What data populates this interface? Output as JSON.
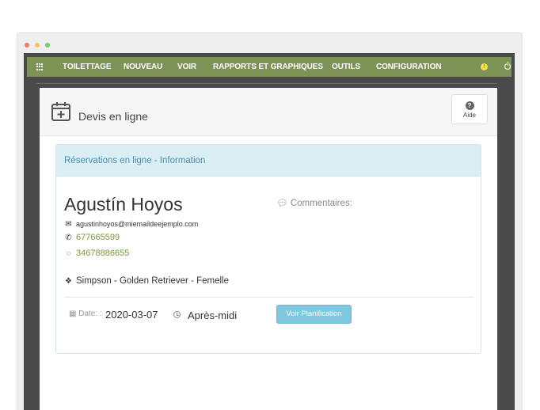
{
  "navbar": {
    "items": [
      "TOILETTAGE",
      "NOUVEAU",
      "VOIR",
      "RAPPORTS ET GRAPHIQUES",
      "OUTILS",
      "CONFIGURATION"
    ],
    "warning_glyph": "!",
    "icons": [
      "grid-icon",
      "warning-icon",
      "power-icon"
    ]
  },
  "header": {
    "title": "Devis en ligne",
    "help_label": "Aide",
    "help_glyph": "?"
  },
  "panel": {
    "title": "Réservations en ligne - Information",
    "client_name": "Agustín Hoyos",
    "email": "agustinhoyos@miemaildeejemplo.com",
    "phone": "677665599",
    "whatsapp": "34678886655",
    "pet": "Simpson - Golden Retriever - Femelle",
    "comments_label": "Commentaires:",
    "date_label": "Date: :",
    "date_value": "2020-03-07",
    "time_value": "Après-midi",
    "plan_button": "Voir Planification"
  },
  "colors": {
    "navbar": "#7d9356",
    "link_green": "#7a9a3d",
    "info_bg": "#dbeef4",
    "info_text": "#4a8eaa",
    "button": "#7fc7de"
  }
}
